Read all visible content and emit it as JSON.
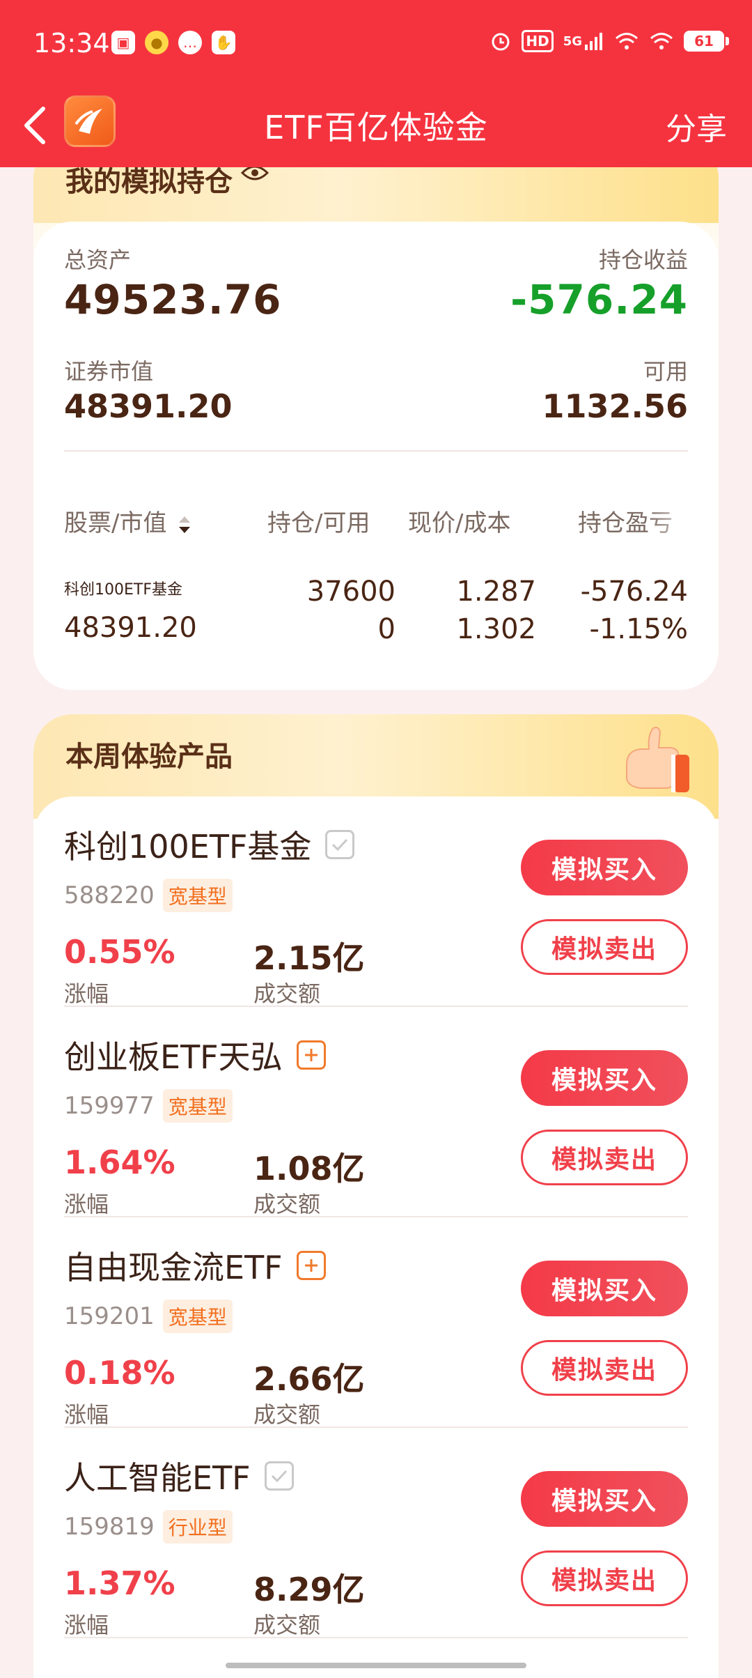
{
  "status_bar": {
    "time": "13:34",
    "network": "5G",
    "hd": "HD",
    "battery": "61"
  },
  "nav": {
    "title": "ETF百亿体验金",
    "share_label": "分享"
  },
  "holdings": {
    "title": "我的模拟持仓",
    "total_assets_label": "总资产",
    "total_assets_value": "49523.76",
    "position_pnl_label": "持仓收益",
    "position_pnl_value": "-576.24",
    "market_value_label": "证券市值",
    "market_value_value": "48391.20",
    "available_label": "可用",
    "available_value": "1132.56",
    "table_headers": {
      "stock_value": "股票/市值",
      "position": "持仓/可用",
      "price_cost": "现价/成本",
      "pnl": "持仓盈亏"
    },
    "rows": [
      {
        "name": "科创100ETF基金",
        "market_value": "48391.20",
        "position": "37600",
        "available": "0",
        "price": "1.287",
        "cost": "1.302",
        "pnl": "-576.24",
        "pnl_pct": "-1.15%"
      }
    ]
  },
  "products": {
    "title": "本周体验产品",
    "buy_label": "模拟买入",
    "sell_label": "模拟卖出",
    "change_label": "涨幅",
    "volume_label": "成交额",
    "items": [
      {
        "name": "科创100ETF基金",
        "code": "588220",
        "tag": "宽基型",
        "change": "0.55%",
        "volume": "2.15亿",
        "added": true
      },
      {
        "name": "创业板ETF天弘",
        "code": "159977",
        "tag": "宽基型",
        "change": "1.64%",
        "volume": "1.08亿",
        "added": false
      },
      {
        "name": "自由现金流ETF",
        "code": "159201",
        "tag": "宽基型",
        "change": "0.18%",
        "volume": "2.66亿",
        "added": false
      },
      {
        "name": "人工智能ETF",
        "code": "159819",
        "tag": "行业型",
        "change": "1.37%",
        "volume": "8.29亿",
        "added": true
      }
    ]
  },
  "colors": {
    "header_red": "#f5333f",
    "gain_red": "#f0404a",
    "loss_green": "#16a02a",
    "tag_orange": "#f26f1e"
  }
}
